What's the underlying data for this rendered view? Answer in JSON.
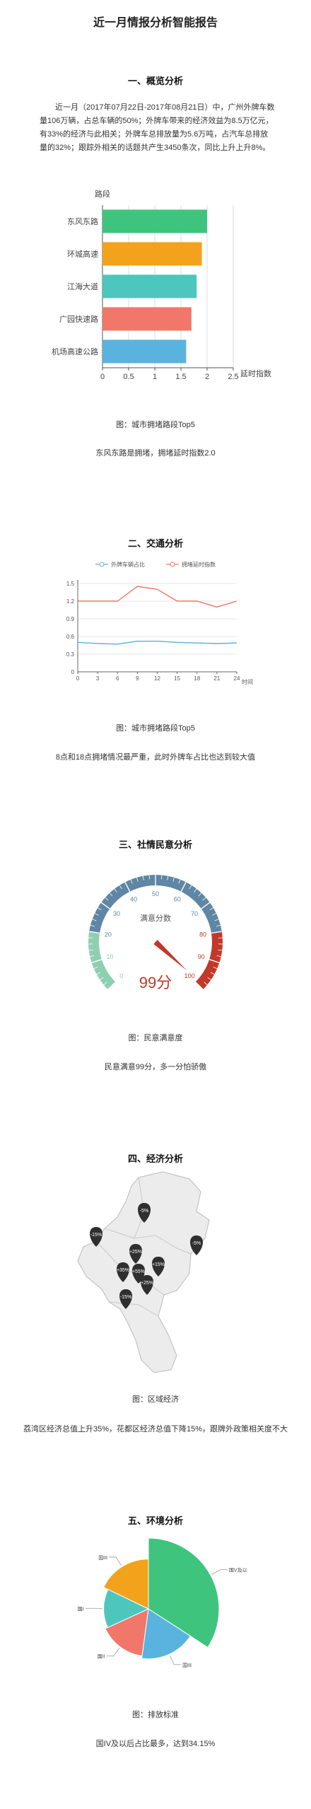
{
  "page": {
    "title": "近一月情报分析智能报告"
  },
  "sections": [
    {
      "heading": "一、概览分析",
      "paragraph": "近一月（2017年07月22日-2017年08月21日）中，广州外牌车数量106万辆，占总车辆的50%；外牌车带来的经济效益为8.5万亿元，有33%的经济与此相关；外牌车总排放量为5.6万吨，占汽车总排放量的32%；跟踪外相关的话题共产生3450条次，同比上升上升8%。",
      "caption": "图：城市拥堵路段Top5",
      "conclusion": "东风东路是拥堵，拥堵延时指数2.0"
    },
    {
      "heading": "二、交通分析",
      "caption": "图：城市拥堵路段Top5",
      "conclusion": "8点和18点拥堵情况最严重，此时外牌车占比也达到较大值"
    },
    {
      "heading": "三、社情民意分析",
      "caption": "图：民意满意度",
      "conclusion": "民意满意99分，多一分怕骄傲"
    },
    {
      "heading": "四、经济分析",
      "caption": "图：区域经济",
      "conclusion": "荔湾区经济总值上升35%，花都区经济总值下降15%，跟牌外政策相关度不大"
    },
    {
      "heading": "五、环境分析",
      "caption": "图：排放标准",
      "conclusion": "国IV及以后占比最多，达到34.15%"
    }
  ],
  "chart_data": [
    {
      "type": "bar",
      "orientation": "horizontal",
      "ylabel": "路段",
      "xlabel": "延时指数",
      "categories": [
        "东风东路",
        "环城高速",
        "江海大道",
        "广园快速路",
        "机场高速公路"
      ],
      "values": [
        2.0,
        1.9,
        1.8,
        1.7,
        1.6
      ],
      "colors": [
        "#3fc47e",
        "#f2a31b",
        "#4dc7bd",
        "#f0776a",
        "#59b3de"
      ],
      "xlim": [
        0,
        2.5
      ],
      "xticks": [
        "0",
        "0.5",
        "1",
        "1.5",
        "2",
        "2.5"
      ],
      "grid": true
    },
    {
      "type": "line",
      "xlabel": "时间",
      "x": [
        0,
        3,
        6,
        9,
        12,
        15,
        18,
        21,
        24
      ],
      "xticks": [
        "0",
        "3",
        "6",
        "9",
        "12",
        "15",
        "18",
        "21",
        "24"
      ],
      "yticks": [
        "0",
        "0.3",
        "0.6",
        "0.9",
        "1.2",
        "1.5"
      ],
      "ylim": [
        0,
        1.5
      ],
      "legend_position": "top",
      "series": [
        {
          "name": "外牌车辆占比",
          "color": "#5ab1d8",
          "values": [
            0.5,
            0.48,
            0.47,
            0.52,
            0.52,
            0.5,
            0.49,
            0.48,
            0.49
          ]
        },
        {
          "name": "拥堵延时指数",
          "color": "#f0776a",
          "values": [
            1.2,
            1.2,
            1.2,
            1.45,
            1.4,
            1.2,
            1.2,
            1.1,
            1.2
          ]
        }
      ]
    },
    {
      "type": "gauge",
      "title": "满意分数",
      "value": 99,
      "value_label": "99分",
      "min": 0,
      "max": 100,
      "tick_labels": [
        "0",
        "10",
        "20",
        "30",
        "40",
        "50",
        "60",
        "70",
        "80",
        "90",
        "100"
      ],
      "band_colors": [
        "#8ecfb2",
        "#5f86a4",
        "#c0392b"
      ],
      "bands": [
        [
          0,
          20
        ],
        [
          20,
          80
        ],
        [
          80,
          100
        ]
      ]
    },
    {
      "type": "map",
      "markers": [
        "-15%",
        "-5%",
        "-5%",
        "+25%",
        "+15%",
        "+35%",
        "+55%",
        "+25%",
        "-15%"
      ]
    },
    {
      "type": "pie",
      "style": "rose",
      "labels": [
        "国V及以后",
        "国III",
        "国II",
        "国I",
        "国III"
      ],
      "colors": [
        "#3fc47e",
        "#59b3de",
        "#f0776a",
        "#4dc7bd",
        "#f2a31b"
      ],
      "values": [
        34.15,
        18,
        16,
        14,
        17.85
      ]
    }
  ]
}
